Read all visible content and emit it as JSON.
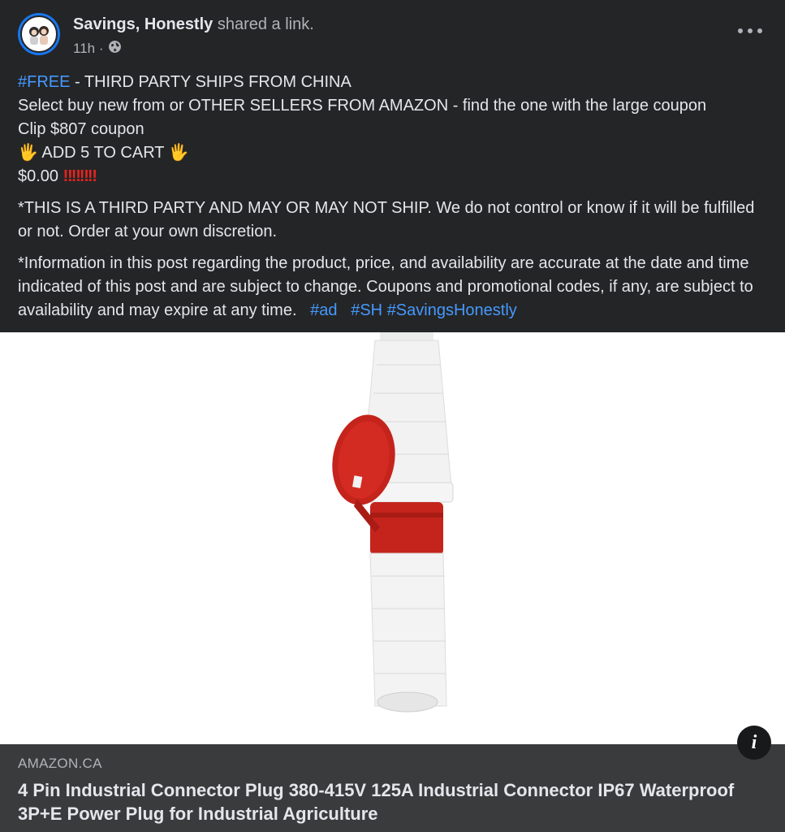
{
  "post": {
    "author": "Savings, Honestly",
    "action": "shared a link.",
    "timestamp": "11h ·",
    "privacy_icon": "globe-icon"
  },
  "body": {
    "line1_tag": "#FREE",
    "line1_rest": " - THIRD PARTY SHIPS FROM CHINA",
    "line2": "Select buy new from or OTHER SELLERS FROM AMAZON - find the one with the large coupon",
    "line3": "Clip $807 coupon",
    "line4_hand": "🖐",
    "line4_text": " ADD 5 TO CART ",
    "line5_price": "$0.00",
    "line5_marks": "‼‼‼‼",
    "disclaimer1": "*THIS IS A THIRD PARTY AND MAY OR MAY NOT SHIP. We do not control or know if it will be fulfilled or not. Order at your own discretion.",
    "disclaimer2": "*Information in this post regarding the product, price, and availability are accurate at  the date and time indicated of this post and are subject to change. Coupons and promotional codes, if any, are subject to availability and may expire at any time.",
    "tags": [
      "#ad",
      "#SH",
      "#SavingsHonestly"
    ]
  },
  "link": {
    "domain": "AMAZON.CA",
    "title": "4 Pin Industrial Connector Plug 380-415V 125A Industrial Connector IP67 Waterproof 3P+E Power Plug for Industrial Agriculture",
    "info_label": "i"
  },
  "colors": {
    "background": "#242526",
    "link_footer": "#3a3b3c",
    "hashtag": "#4599ff",
    "plug_red": "#c4241c"
  }
}
